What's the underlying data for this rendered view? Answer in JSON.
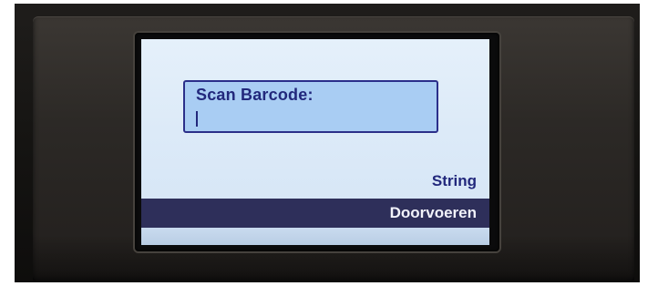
{
  "screen": {
    "input_label": "Scan Barcode:",
    "input_value": "",
    "mode_label": "String",
    "softkey_label": "Doorvoeren"
  }
}
